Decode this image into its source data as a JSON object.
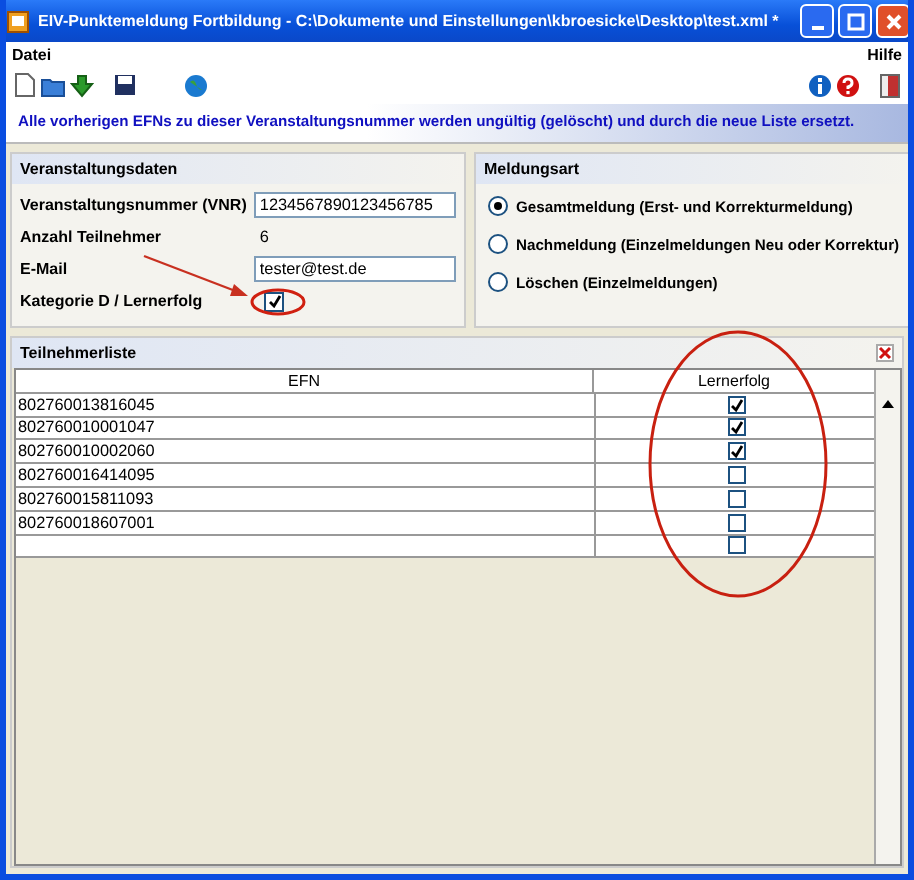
{
  "window": {
    "title": "EIV-Punktemeldung Fortbildung - C:\\Dokumente und Einstellungen\\kbroesicke\\Desktop\\test.xml *"
  },
  "menu": {
    "left": "Datei",
    "right": "Hilfe"
  },
  "banner": "Alle vorherigen EFNs zu dieser Veranstaltungsnummer werden ungültig (gelöscht) und durch die neue Liste ersetzt.",
  "event_panel": {
    "title": "Veranstaltungsdaten",
    "fields": [
      {
        "label": "Veranstaltungsnummer (VNR)",
        "value": "1234567890123456785",
        "kind": "input"
      },
      {
        "label": "Anzahl Teilnehmer",
        "value": "6",
        "kind": "readonly"
      },
      {
        "label": "E-Mail",
        "value": "tester@test.de",
        "kind": "input"
      },
      {
        "label": "Kategorie D / Lernerfolg",
        "checked": true,
        "kind": "checkbox"
      }
    ]
  },
  "report_panel": {
    "title": "Meldungsart",
    "options": [
      {
        "label": "Gesamtmeldung (Erst- und Korrekturmeldung)",
        "selected": true
      },
      {
        "label": "Nachmeldung (Einzelmeldungen Neu oder Korrektur)",
        "selected": false
      },
      {
        "label": "Löschen (Einzelmeldungen)",
        "selected": false
      }
    ]
  },
  "participants": {
    "title": "Teilnehmerliste",
    "columns": [
      "EFN",
      "Lernerfolg"
    ],
    "rows": [
      {
        "efn": "802760013816045",
        "checked": true
      },
      {
        "efn": "802760010001047",
        "checked": true
      },
      {
        "efn": "802760010002060",
        "checked": true
      },
      {
        "efn": "802760016414095",
        "checked": false
      },
      {
        "efn": "802760015811093",
        "checked": false
      },
      {
        "efn": "802760018607001",
        "checked": false
      },
      {
        "checked": false
      }
    ]
  }
}
